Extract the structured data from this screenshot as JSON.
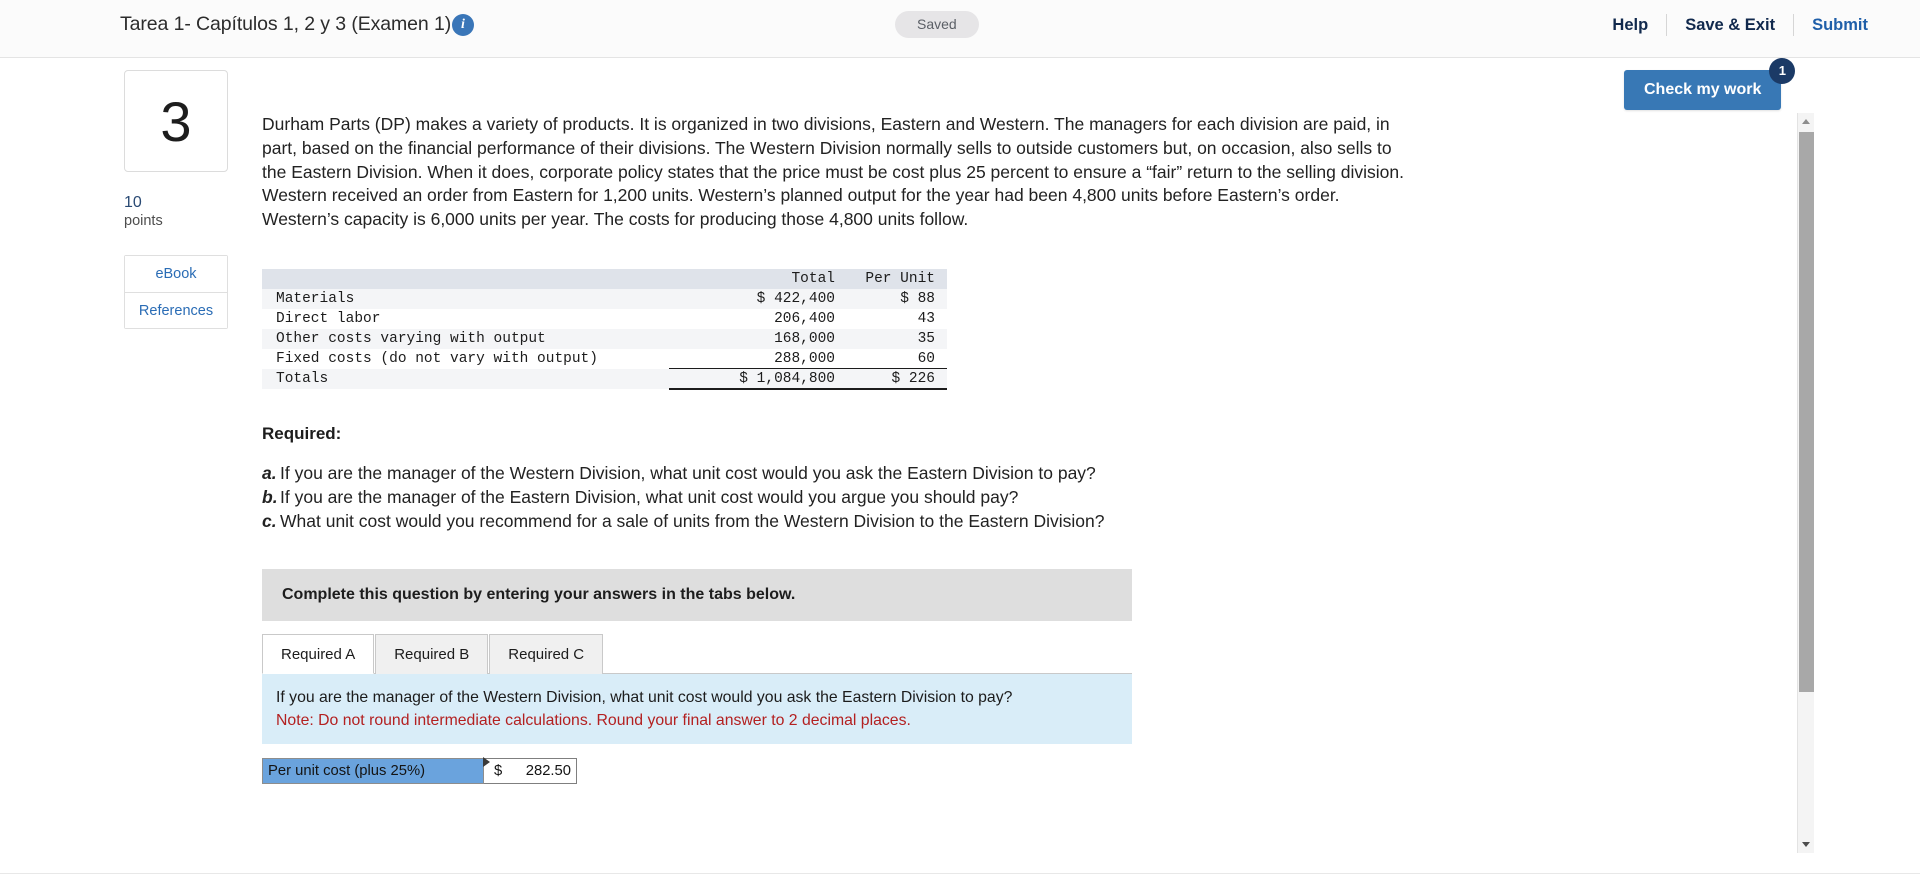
{
  "header": {
    "exam_title": "Tarea 1- Capítulos 1, 2 y 3 (Examen 1)",
    "info_icon_glyph": "i",
    "saved_status": "Saved",
    "help_label": "Help",
    "save_exit_label": "Save & Exit",
    "submit_label": "Submit"
  },
  "check_my_work": {
    "label": "Check my work",
    "badge_count": "1"
  },
  "rail": {
    "question_number": "3",
    "points_value": "10",
    "points_label": "points",
    "ebook_label": "eBook",
    "references_label": "References"
  },
  "question": {
    "body": "Durham Parts (DP) makes a variety of products. It is organized in two divisions, Eastern and Western. The managers for each division are paid, in part, based on the financial performance of their divisions. The Western Division normally sells to outside customers but, on occasion, also sells to the Eastern Division. When it does, corporate policy states that the price must be cost plus 25 percent to ensure a “fair” return to the selling division. Western received an order from Eastern for 1,200 units. Western’s planned output for the year had been 4,800 units before Eastern’s order. Western’s capacity is 6,000 units per year. The costs for producing those 4,800 units follow."
  },
  "cost_table": {
    "columns": [
      "",
      "Total",
      "Per Unit"
    ],
    "rows": [
      {
        "label": "Materials",
        "total": "$ 422,400",
        "per_unit": "$ 88"
      },
      {
        "label": "Direct labor",
        "total": "206,400",
        "per_unit": "43"
      },
      {
        "label": "Other costs varying with output",
        "total": "168,000",
        "per_unit": "35"
      },
      {
        "label": "Fixed costs (do not vary with output)",
        "total": "288,000",
        "per_unit": "60"
      }
    ],
    "totals": {
      "label": "Totals",
      "total": "$ 1,084,800",
      "per_unit": "$ 226"
    }
  },
  "required": {
    "heading": "Required:",
    "items": [
      {
        "marker": "a.",
        "text": "If you are the manager of the Western Division, what unit cost would you ask the Eastern Division to pay?"
      },
      {
        "marker": "b.",
        "text": "If you are the manager of the Eastern Division, what unit cost would you argue you should pay?"
      },
      {
        "marker": "c.",
        "text": "What unit cost would you recommend for a sale of units from the Western Division to the Eastern Division?"
      }
    ]
  },
  "answer_panel": {
    "instruction": "Complete this question by entering your answers in the tabs below.",
    "tabs": [
      {
        "label": "Required A",
        "active": true
      },
      {
        "label": "Required B",
        "active": false
      },
      {
        "label": "Required C",
        "active": false
      }
    ],
    "tab_question": "If you are the manager of the Western Division, what unit cost would you ask the Eastern Division to pay?",
    "tab_note": "Note: Do not round intermediate calculations. Round your final answer to 2 decimal places.",
    "answer_row": {
      "label": "Per unit cost (plus 25%)",
      "currency_symbol": "$",
      "value": "282.50"
    }
  },
  "colors": {
    "accent_blue": "#3878b5",
    "link_blue": "#2a6cb5",
    "note_red": "#b32020",
    "answer_label_blue": "#6aa3dd",
    "tab_body_blue": "#d9edf8"
  }
}
